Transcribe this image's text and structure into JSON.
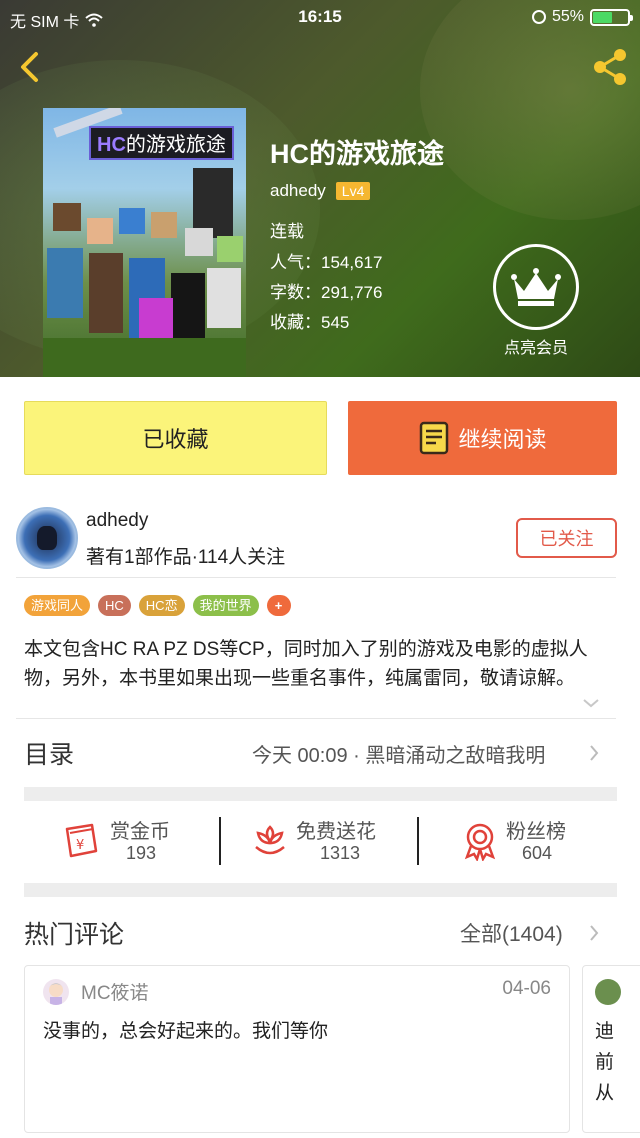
{
  "status_bar": {
    "carrier": "无 SIM 卡",
    "time": "16:15",
    "battery": "55%",
    "battery_level": 0.55
  },
  "book": {
    "cover_title": "HC的游戏旅途",
    "cover_title_hc": "HC",
    "cover_title_rest": "的游戏旅途",
    "title": "HC的游戏旅途",
    "author": "adhedy",
    "level": "Lv4",
    "status": "连载",
    "popularity": "人气：154,617",
    "word_count": "字数：291,776",
    "favorites": "收藏：545"
  },
  "vip": {
    "label": "点亮会员"
  },
  "actions": {
    "favorited_label": "已收藏",
    "continue_label": "继续阅读"
  },
  "author_card": {
    "name": "adhedy",
    "stats": "著有1部作品·114人关注",
    "follow_label": "已关注"
  },
  "tags": [
    {
      "label": "游戏同人",
      "color": "#f2a33a"
    },
    {
      "label": "HC",
      "color": "#c8705a"
    },
    {
      "label": "HC恋",
      "color": "#d9a23a"
    },
    {
      "label": "我的世界",
      "color": "#8cbf4a"
    },
    {
      "label": "+",
      "color": "#ef6a3c"
    }
  ],
  "synopsis": "本文包含HC RA PZ DS等CP，同时加入了别的游戏及电影的虚拟人物，另外，本书里如果出现一些重名事件，纯属雷同，敬请谅解。",
  "toc": {
    "label": "目录",
    "latest": "今天 00:09 · 黑暗涌动之敌暗我明"
  },
  "stats": [
    {
      "label": "赏金币",
      "value": "193",
      "icon": "red-envelope-icon"
    },
    {
      "label": "免费送花",
      "value": "1313",
      "icon": "flower-icon"
    },
    {
      "label": "粉丝榜",
      "value": "604",
      "icon": "medal-icon"
    }
  ],
  "comments": {
    "label": "热门评论",
    "all_label": "全部(1404)",
    "items": [
      {
        "user": "MC筱诺",
        "date": "04-06",
        "text": "没事的，总会好起来的。我们等你"
      },
      {
        "text": "迪前从"
      }
    ]
  },
  "colors": {
    "accent_orange": "#ef6a3c",
    "favorite_yellow": "#fbf47a",
    "follow_red": "#e25a4a",
    "level_gold": "#f5b731"
  }
}
